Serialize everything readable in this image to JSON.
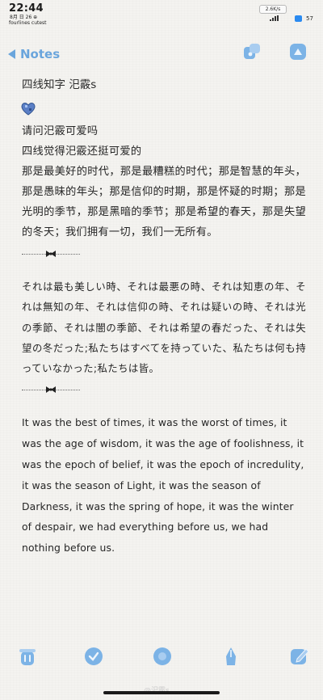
{
  "status_bar": {
    "time": "22:44",
    "date_line": "8月 日 26 ⊕",
    "subtitle": "fourlines cutest",
    "net_speed": "2.6K/s",
    "battery": "57"
  },
  "toolbar": {
    "back_label": "Notes",
    "icons": [
      "back-arrow-icon",
      "export-icon",
      "theme-icon"
    ]
  },
  "note": {
    "title": "四线知字 汜霰s",
    "question": "请问汜霰可爱吗",
    "answer": "四线觉得汜霰还挺可爱的",
    "cn_paragraph": "那是最美好的时代，那是最糟糕的时代；那是智慧的年头，那是愚昧的年头；那是信仰的时期，那是怀疑的时期；那是光明的季节，那是黑暗的季节；那是希望的春天，那是失望的冬天；我们拥有一切，我们一无所有。",
    "jp_paragraph": "それは最も美しい時、それは最悪の時、それは知恵の年、それは無知の年、それは信仰の時、それは疑いの時、それは光の季節、それは闇の季節、それは希望の春だった、それは失望の冬だった;私たちはすべてを持っていた、私たちは何も持っていなかった;私たちは皆。",
    "en_paragraph": "It was the best of times, it was the worst of times, it was the age of wisdom, it was the age of foolishness, it was the epoch of belief, it was the epoch of incredulity, it was the season of Light, it was the season of Darkness, it was the spring of hope, it was the winter of despair, we had everything before us, we had nothing before us."
  },
  "bottom_bar": {
    "icons": [
      "delete-icon",
      "checklist-icon",
      "record-icon",
      "pen-icon",
      "edit-icon"
    ]
  },
  "watermark": "@汜霰s",
  "colors": {
    "accent": "#6aa5dc",
    "background": "#f4f3f0",
    "text": "#262626"
  }
}
